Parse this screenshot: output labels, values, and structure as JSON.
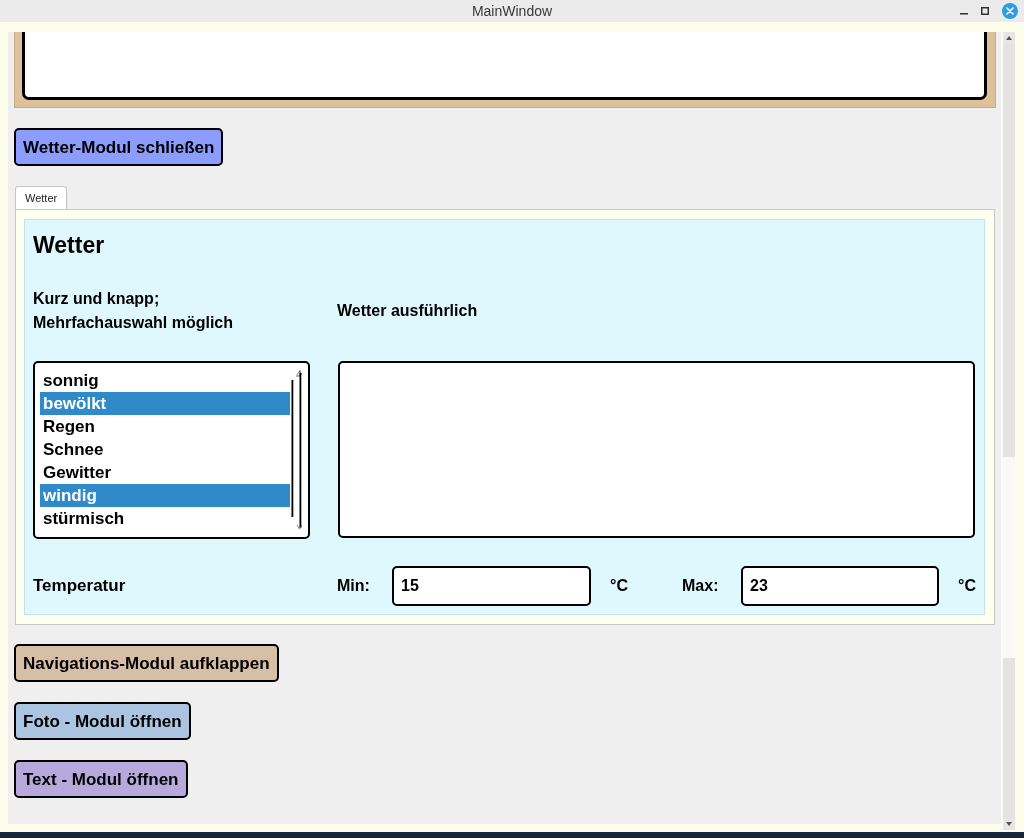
{
  "window": {
    "title": "MainWindow"
  },
  "weather_toggle": {
    "label": "Wetter-Modul schließen",
    "color": "#8c9cff"
  },
  "tabs": [
    {
      "label": "Wetter",
      "selected": true
    }
  ],
  "weather": {
    "heading": "Wetter",
    "short_label": "Kurz und knapp;\nMehrfachauswahl möglich",
    "detail_label": "Wetter ausführlich",
    "conditions": [
      {
        "label": "sonnig",
        "selected": false
      },
      {
        "label": "bewölkt",
        "selected": true
      },
      {
        "label": "Regen",
        "selected": false
      },
      {
        "label": "Schnee",
        "selected": false
      },
      {
        "label": "Gewitter",
        "selected": false
      },
      {
        "label": "windig",
        "selected": true
      },
      {
        "label": "stürmisch",
        "selected": false
      }
    ],
    "temperature": {
      "label": "Temperatur",
      "min_label": "Min:",
      "min_value": "15",
      "min_unit": "°C",
      "max_label": "Max:",
      "max_value": "23",
      "max_unit": "°C"
    }
  },
  "module_buttons": [
    {
      "label": "Navigations-Modul aufklappen",
      "color": "#d6bfa6"
    },
    {
      "label": "Foto - Modul öffnen",
      "color": "#abc4df"
    },
    {
      "label": "Text - Modul öffnen",
      "color": "#b8a9dd"
    }
  ]
}
